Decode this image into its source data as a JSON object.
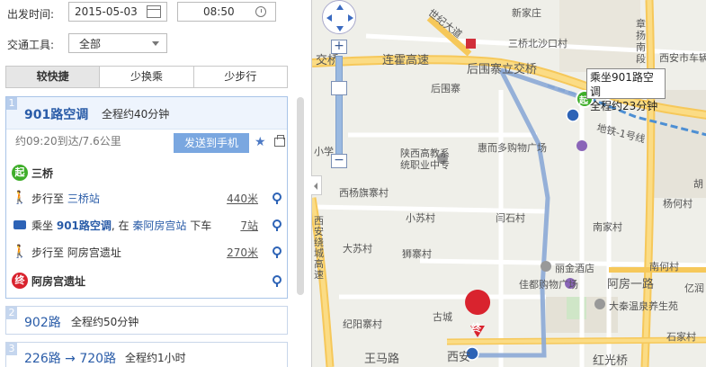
{
  "form": {
    "depart_label": "出发时间:",
    "date_value": "2015-05-03",
    "time_value": "08:50",
    "transport_label": "交通工具:",
    "transport_value": "全部"
  },
  "tabs": [
    {
      "label": "较快捷",
      "active": true
    },
    {
      "label": "少换乘",
      "active": false
    },
    {
      "label": "少步行",
      "active": false
    }
  ],
  "route1": {
    "index": "1",
    "title": "901路空调",
    "duration": "全程约40分钟",
    "summary": "约09:20到达/7.6公里",
    "send_label": "发送到手机",
    "steps": {
      "start": "三桥",
      "walk1_prefix": "步行至",
      "walk1_place": "三桥站",
      "walk1_dist": "440米",
      "ride_prefix": "乘坐",
      "ride_line": "901路空调",
      "ride_mid": ", 在",
      "ride_stop": "秦阿房宫站",
      "ride_suffix": "下车",
      "ride_stops": "7站",
      "walk2_text": "步行至 阿房宫遗址",
      "walk2_dist": "270米",
      "end": "阿房宫遗址"
    },
    "start_badge": "起",
    "end_badge": "终"
  },
  "route2": {
    "index": "2",
    "title": "902路",
    "duration": "全程约50分钟"
  },
  "route3": {
    "index": "3",
    "title": "226路 → 720路",
    "duration": "全程约1小时"
  },
  "map": {
    "tooltip_line1": "乘坐901路空调",
    "tooltip_line2": "全程约23分钟",
    "zoom_in": "+",
    "zoom_out": "−",
    "labels": {
      "xinzhuang": "新家庄",
      "sanqiao_north": "三桥北沙口村",
      "zhangyangnan": "章扬南段",
      "xian_car": "西安市车辆",
      "shiji": "世纪大道",
      "jiaotong": "交桥",
      "lianhuo": "连霍高速",
      "houwei": "后围寨立交桥",
      "houwei2": "后围寨",
      "subway": "地铁-1号线",
      "school": "陕西高教系统职业中专",
      "huier": "惠而多购物广场",
      "xiaoxue": "小学",
      "xiyang": "西杨旗寨村",
      "xiaofang": "小苏村",
      "xiaoshi": "闫石村",
      "xiao_xian": "西安绕城高速",
      "nanjia": "南家村",
      "yangjia": "杨何村",
      "dashu": "大苏村",
      "shizhai": "狮寨村",
      "lijin": "丽金酒店",
      "jiadu": "佳都购物广场",
      "afang": "阿房一路",
      "nanhe": "南何村",
      "daqin": "大秦温泉养生苑",
      "yicheng": "亿润",
      "guzhen": "古城",
      "jiyang": "纪阳寨村",
      "shijia": "石家村",
      "wangma": "王马路",
      "xisan": "西安",
      "hongguang": "红光桥",
      "hu": "胡"
    },
    "start_marker": "起",
    "end_marker": "终"
  }
}
